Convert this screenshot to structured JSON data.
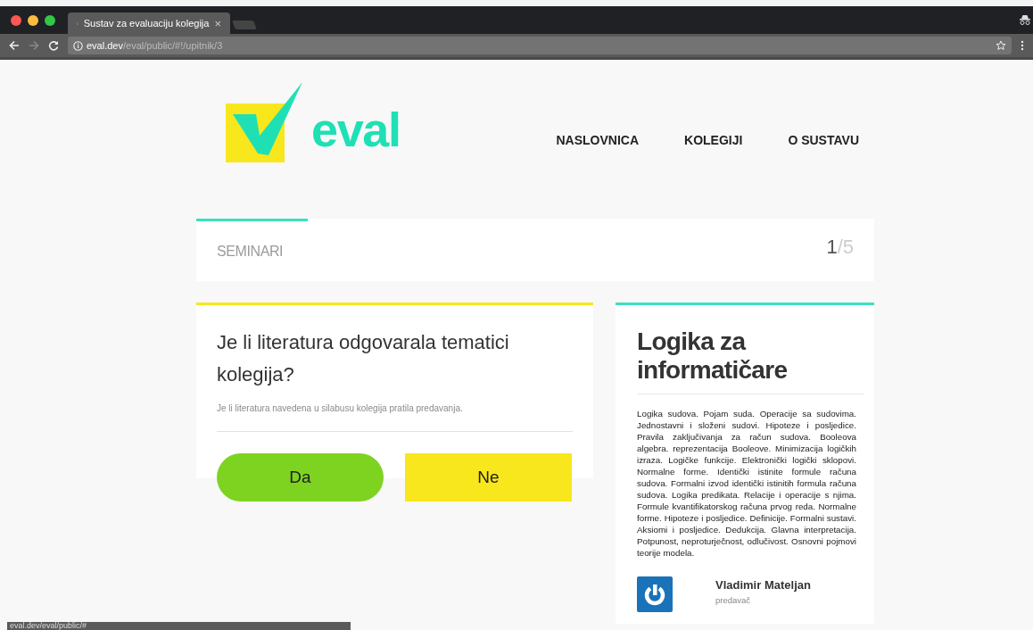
{
  "browser": {
    "tab_title": "Sustav za evaluaciju kolegija",
    "tab_close": "×",
    "url_host": "eval.dev",
    "url_path": "/eval/public/#!/upitnik/3",
    "status_url": "eval.dev/eval/public/#"
  },
  "logo": {
    "text": "eval"
  },
  "nav": [
    {
      "label": "NASLOVNICA"
    },
    {
      "label": "KOLEGIJI"
    },
    {
      "label": "O SUSTAVU"
    }
  ],
  "progress": {
    "section": "SEMINARI",
    "current": "1",
    "total": "/5",
    "level": 0.165
  },
  "question": {
    "title": "Je li literatura odgovarala tematici kolegija?",
    "hint": "Je li literatura navedena u silabusu kolegija pratila predavanja."
  },
  "answers": [
    {
      "label": "Da",
      "kind": "pill",
      "color": "#7ed321"
    },
    {
      "label": "Ne",
      "kind": "rect",
      "color": "#f8e71c"
    }
  ],
  "course": {
    "title": "Logika za informatičare",
    "description": "Logika sudova. Pojam suda. Operacije sa sudovima. Jednostavni i složeni sudovi. Hipoteze i posljedice. Pravila zaključivanja za račun sudova. Booleova algebra. reprezentacija Booleove. Minimizacija logičkih izraza. Logičke funkcije. Elektronički logički sklopovi. Normalne forme. Identički istinite formule računa sudova. Formalni izvod identički istinitih formula računa sudova. Logika predikata. Relacije i operacije s njima. Formule kvantifikatorskog računa prvog reda. Normalne forme. Hipoteze i posljedice. Definicije. Formalni sustavi. Aksiomi i posljedice. Dedukcija. Glavna interpretacija. Potpunost, neproturječnost, odlučivost. Osnovni pojmovi teorije modela.",
    "lecturer": "Vladimir Mateljan",
    "role": "predavač"
  }
}
